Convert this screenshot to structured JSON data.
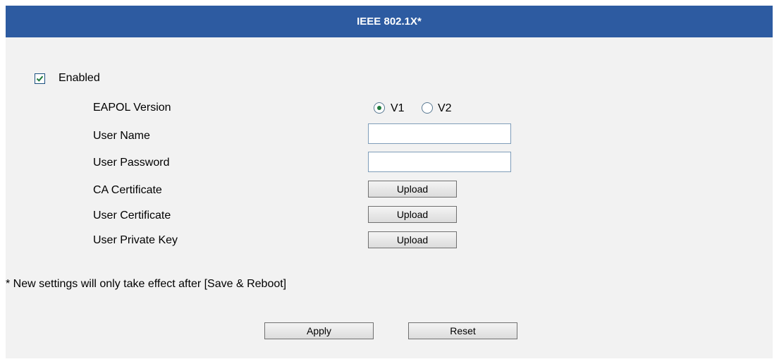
{
  "header": {
    "title": "IEEE 802.1X*"
  },
  "enabled": {
    "label": "Enabled",
    "checked": true
  },
  "fields": {
    "eapol_version": {
      "label": "EAPOL Version",
      "options": [
        "V1",
        "V2"
      ],
      "selected": "V1"
    },
    "user_name": {
      "label": "User Name",
      "value": ""
    },
    "user_password": {
      "label": "User Password",
      "value": ""
    },
    "ca_certificate": {
      "label": "CA Certificate",
      "button": "Upload"
    },
    "user_certificate": {
      "label": "User Certificate",
      "button": "Upload"
    },
    "user_private_key": {
      "label": "User Private Key",
      "button": "Upload"
    }
  },
  "note": "* New settings will only take effect after [Save & Reboot]",
  "actions": {
    "apply": "Apply",
    "reset": "Reset"
  },
  "colors": {
    "header_bg": "#2d5ba1",
    "panel_bg": "#f2f2f2",
    "check": "#1f7a3a"
  }
}
